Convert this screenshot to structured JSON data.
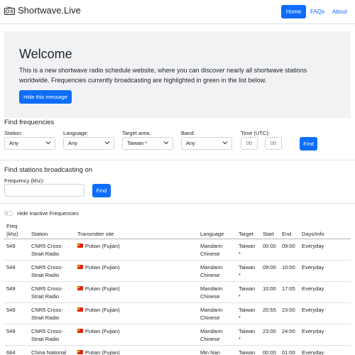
{
  "nav": {
    "brand": "Shortwave.Live",
    "links": [
      "Home",
      "FAQs",
      "About"
    ]
  },
  "hero": {
    "title": "Welcome",
    "text": "This is a new shortwave radio schedule website, where you can discover nearly all shortwave stations worldwide. Frequencies currently broadcasting are highlighted in green in the list below.",
    "button": "Hide this message"
  },
  "find_frequencies": {
    "title": "Find frequencies",
    "station_label": "Station:",
    "station_value": "Any",
    "language_label": "Language:",
    "language_value": "Any",
    "target_label": "Target area:",
    "target_value": "Taiwan *",
    "band_label": "Band:",
    "band_value": "Any",
    "time_label": "Time (UTC):",
    "time_from_placeholder": "00",
    "time_to_placeholder": "00",
    "button": "Find"
  },
  "find_stations": {
    "title": "Find stations broadcasting on",
    "freq_label": "Frequency (khz):",
    "freq_value": "",
    "button": "Find"
  },
  "toggle_label": "Hide Inactive Frequencies",
  "table": {
    "headers": {
      "freq_1": "Freq",
      "freq_2": "(khz)",
      "station": "Station",
      "site": "Transmitter site",
      "language": "Language",
      "target": "Target",
      "start": "Start",
      "end": "End",
      "days": "Days/Info"
    },
    "rows": [
      {
        "freq": "549",
        "station_1": "CNR5 Cross-",
        "station_2": "Strait Radio",
        "site": "Putian (Fujian)",
        "lang_1": "Mandarin",
        "lang_2": "Chinese",
        "target_1": "Taiwan",
        "target_2": "*",
        "start": "00:00",
        "end": "09:00",
        "days": "Everyday"
      },
      {
        "freq": "549",
        "station_1": "CNR5 Cross-",
        "station_2": "Strait Radio",
        "site": "Putian (Fujian)",
        "lang_1": "Mandarin",
        "lang_2": "Chinese",
        "target_1": "Taiwan",
        "target_2": "*",
        "start": "09:00",
        "end": "10:00",
        "days": "Everyday"
      },
      {
        "freq": "549",
        "station_1": "CNR5 Cross-",
        "station_2": "Strait Radio",
        "site": "Putian (Fujian)",
        "lang_1": "Mandarin",
        "lang_2": "Chinese",
        "target_1": "Taiwan",
        "target_2": "*",
        "start": "10:00",
        "end": "17:05",
        "days": "Everyday"
      },
      {
        "freq": "549",
        "station_1": "CNR5 Cross-",
        "station_2": "Strait Radio",
        "site": "Putian (Fujian)",
        "lang_1": "Mandarin",
        "lang_2": "Chinese",
        "target_1": "Taiwan",
        "target_2": "*",
        "start": "20:55",
        "end": "23:00",
        "days": "Everyday"
      },
      {
        "freq": "549",
        "station_1": "CNR5 Cross-",
        "station_2": "Strait Radio",
        "site": "Putian (Fujian)",
        "lang_1": "Mandarin",
        "lang_2": "Chinese",
        "target_1": "Taiwan",
        "target_2": "*",
        "start": "23:00",
        "end": "24:00",
        "days": "Everyday"
      },
      {
        "freq": "684",
        "station_1": "China National",
        "station_2": "",
        "site": "Putian (Fujian)",
        "lang_1": "Min Nan",
        "lang_2": "",
        "target_1": "Taiwan",
        "target_2": "",
        "start": "00:00",
        "end": "01:00",
        "days": "Everyday"
      }
    ]
  },
  "colors": {
    "accent": "#0d6efd",
    "hero_bg": "#f1f2f4",
    "border": "#dee2e6"
  }
}
